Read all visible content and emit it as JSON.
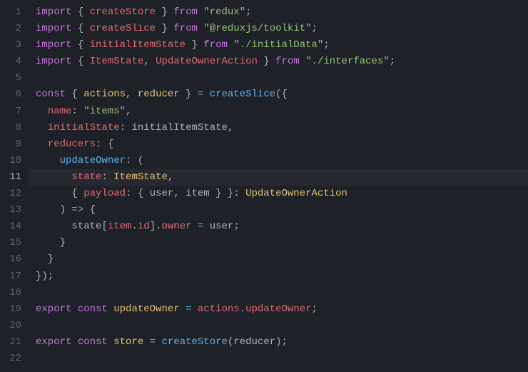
{
  "lines": [
    {
      "num": "1",
      "tokens": [
        {
          "t": "import",
          "c": "kw"
        },
        {
          "t": " { ",
          "c": "punc"
        },
        {
          "t": "createStore",
          "c": "id"
        },
        {
          "t": " } ",
          "c": "punc"
        },
        {
          "t": "from",
          "c": "kw"
        },
        {
          "t": " ",
          "c": "punc"
        },
        {
          "t": "\"redux\"",
          "c": "str"
        },
        {
          "t": ";",
          "c": "punc"
        }
      ]
    },
    {
      "num": "2",
      "tokens": [
        {
          "t": "import",
          "c": "kw"
        },
        {
          "t": " { ",
          "c": "punc"
        },
        {
          "t": "createSlice",
          "c": "id"
        },
        {
          "t": " } ",
          "c": "punc"
        },
        {
          "t": "from",
          "c": "kw"
        },
        {
          "t": " ",
          "c": "punc"
        },
        {
          "t": "\"@reduxjs/toolkit\"",
          "c": "str"
        },
        {
          "t": ";",
          "c": "punc"
        }
      ]
    },
    {
      "num": "3",
      "tokens": [
        {
          "t": "import",
          "c": "kw"
        },
        {
          "t": " { ",
          "c": "punc"
        },
        {
          "t": "initialItemState",
          "c": "id"
        },
        {
          "t": " } ",
          "c": "punc"
        },
        {
          "t": "from",
          "c": "kw"
        },
        {
          "t": " ",
          "c": "punc"
        },
        {
          "t": "\"./initialData\"",
          "c": "str"
        },
        {
          "t": ";",
          "c": "punc"
        }
      ]
    },
    {
      "num": "4",
      "tokens": [
        {
          "t": "import",
          "c": "kw"
        },
        {
          "t": " { ",
          "c": "punc"
        },
        {
          "t": "ItemState",
          "c": "id"
        },
        {
          "t": ", ",
          "c": "punc"
        },
        {
          "t": "UpdateOwnerAction",
          "c": "id"
        },
        {
          "t": " } ",
          "c": "punc"
        },
        {
          "t": "from",
          "c": "kw"
        },
        {
          "t": " ",
          "c": "punc"
        },
        {
          "t": "\"./interfaces\"",
          "c": "str"
        },
        {
          "t": ";",
          "c": "punc"
        }
      ]
    },
    {
      "num": "5",
      "tokens": []
    },
    {
      "num": "6",
      "tokens": [
        {
          "t": "const",
          "c": "kw"
        },
        {
          "t": " { ",
          "c": "punc"
        },
        {
          "t": "actions",
          "c": "type"
        },
        {
          "t": ", ",
          "c": "punc"
        },
        {
          "t": "reducer",
          "c": "type"
        },
        {
          "t": " } ",
          "c": "punc"
        },
        {
          "t": "=",
          "c": "eq"
        },
        {
          "t": " ",
          "c": "punc"
        },
        {
          "t": "createSlice",
          "c": "fn"
        },
        {
          "t": "({",
          "c": "punc"
        }
      ]
    },
    {
      "num": "7",
      "tokens": [
        {
          "t": "  ",
          "c": "punc"
        },
        {
          "t": "name",
          "c": "prop"
        },
        {
          "t": ": ",
          "c": "punc"
        },
        {
          "t": "\"items\"",
          "c": "str"
        },
        {
          "t": ",",
          "c": "punc"
        }
      ]
    },
    {
      "num": "8",
      "tokens": [
        {
          "t": "  ",
          "c": "punc"
        },
        {
          "t": "initialState",
          "c": "prop"
        },
        {
          "t": ": ",
          "c": "punc"
        },
        {
          "t": "initialItemState",
          "c": "var"
        },
        {
          "t": ",",
          "c": "punc"
        }
      ]
    },
    {
      "num": "9",
      "tokens": [
        {
          "t": "  ",
          "c": "punc"
        },
        {
          "t": "reducers",
          "c": "prop"
        },
        {
          "t": ": {",
          "c": "punc"
        }
      ]
    },
    {
      "num": "10",
      "tokens": [
        {
          "t": "    ",
          "c": "punc"
        },
        {
          "t": "updateOwner",
          "c": "fn"
        },
        {
          "t": ": (",
          "c": "punc"
        }
      ]
    },
    {
      "num": "11",
      "active": true,
      "tokens": [
        {
          "t": "      ",
          "c": "punc"
        },
        {
          "t": "state",
          "c": "prop"
        },
        {
          "t": ": ",
          "c": "punc"
        },
        {
          "t": "ItemState",
          "c": "type"
        },
        {
          "t": ",",
          "c": "punc"
        }
      ]
    },
    {
      "num": "12",
      "tokens": [
        {
          "t": "      { ",
          "c": "punc"
        },
        {
          "t": "payload",
          "c": "prop"
        },
        {
          "t": ": { ",
          "c": "punc"
        },
        {
          "t": "user",
          "c": "var"
        },
        {
          "t": ", ",
          "c": "punc"
        },
        {
          "t": "item",
          "c": "var"
        },
        {
          "t": " } }: ",
          "c": "punc"
        },
        {
          "t": "UpdateOwnerAction",
          "c": "type"
        }
      ]
    },
    {
      "num": "13",
      "tokens": [
        {
          "t": "    ) ",
          "c": "punc"
        },
        {
          "t": "=>",
          "c": "arr"
        },
        {
          "t": " {",
          "c": "punc"
        }
      ]
    },
    {
      "num": "14",
      "tokens": [
        {
          "t": "      ",
          "c": "punc"
        },
        {
          "t": "state",
          "c": "var"
        },
        {
          "t": "[",
          "c": "punc"
        },
        {
          "t": "item",
          "c": "id"
        },
        {
          "t": ".",
          "c": "punc"
        },
        {
          "t": "id",
          "c": "id"
        },
        {
          "t": "].",
          "c": "punc"
        },
        {
          "t": "owner",
          "c": "id"
        },
        {
          "t": " ",
          "c": "punc"
        },
        {
          "t": "=",
          "c": "eq"
        },
        {
          "t": " ",
          "c": "punc"
        },
        {
          "t": "user",
          "c": "var"
        },
        {
          "t": ";",
          "c": "punc"
        }
      ]
    },
    {
      "num": "15",
      "tokens": [
        {
          "t": "    }",
          "c": "punc"
        }
      ]
    },
    {
      "num": "16",
      "tokens": [
        {
          "t": "  }",
          "c": "punc"
        }
      ]
    },
    {
      "num": "17",
      "tokens": [
        {
          "t": "});",
          "c": "punc"
        }
      ]
    },
    {
      "num": "18",
      "tokens": []
    },
    {
      "num": "19",
      "tokens": [
        {
          "t": "export",
          "c": "kw"
        },
        {
          "t": " ",
          "c": "punc"
        },
        {
          "t": "const",
          "c": "kw"
        },
        {
          "t": " ",
          "c": "punc"
        },
        {
          "t": "updateOwner",
          "c": "type"
        },
        {
          "t": " ",
          "c": "punc"
        },
        {
          "t": "=",
          "c": "eq"
        },
        {
          "t": " ",
          "c": "punc"
        },
        {
          "t": "actions",
          "c": "id"
        },
        {
          "t": ".",
          "c": "punc"
        },
        {
          "t": "updateOwner",
          "c": "id"
        },
        {
          "t": ";",
          "c": "punc"
        }
      ]
    },
    {
      "num": "20",
      "tokens": []
    },
    {
      "num": "21",
      "tokens": [
        {
          "t": "export",
          "c": "kw"
        },
        {
          "t": " ",
          "c": "punc"
        },
        {
          "t": "const",
          "c": "kw"
        },
        {
          "t": " ",
          "c": "punc"
        },
        {
          "t": "store",
          "c": "type"
        },
        {
          "t": " ",
          "c": "punc"
        },
        {
          "t": "=",
          "c": "eq"
        },
        {
          "t": " ",
          "c": "punc"
        },
        {
          "t": "createStore",
          "c": "fn"
        },
        {
          "t": "(",
          "c": "punc"
        },
        {
          "t": "reducer",
          "c": "var"
        },
        {
          "t": ");",
          "c": "punc"
        }
      ]
    },
    {
      "num": "22",
      "tokens": []
    }
  ]
}
